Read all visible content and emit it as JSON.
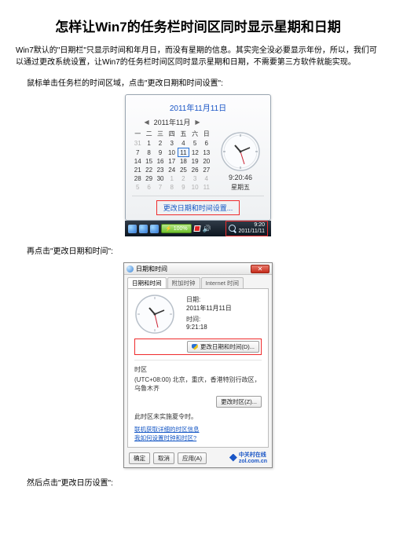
{
  "title": "怎样让Win7的任务栏时间区同时显示星期和日期",
  "intro": "Win7默认的\"日期栏\"只显示时间和年月日，而没有星期的信息。其实完全没必要显示年份，所以，我们可以通过更改系统设置，让Win7的任务栏时间区同时显示星期和日期，不需要第三方软件就能实现。",
  "step1": "鼠标单击任务栏的时间区域，点击\"更改日期和时间设置\":",
  "step2": "再点击\"更改日期和时间\":",
  "step3": "然后点击\"更改日历设置\":",
  "calendar": {
    "today_full": "2011年11月11日",
    "month_label": "2011年11月",
    "dow": [
      "一",
      "二",
      "三",
      "四",
      "五",
      "六",
      "日"
    ],
    "rows": [
      {
        "cells": [
          "31",
          "1",
          "2",
          "3",
          "4",
          "5",
          "6"
        ],
        "other": [
          0
        ]
      },
      {
        "cells": [
          "7",
          "8",
          "9",
          "10",
          "11",
          "12",
          "13"
        ],
        "sel": 4
      },
      {
        "cells": [
          "14",
          "15",
          "16",
          "17",
          "18",
          "19",
          "20"
        ]
      },
      {
        "cells": [
          "21",
          "22",
          "23",
          "24",
          "25",
          "26",
          "27"
        ]
      },
      {
        "cells": [
          "28",
          "29",
          "30",
          "1",
          "2",
          "3",
          "4"
        ],
        "other": [
          3,
          4,
          5,
          6
        ]
      },
      {
        "cells": [
          "5",
          "6",
          "7",
          "8",
          "9",
          "10",
          "11"
        ],
        "other": [
          0,
          1,
          2,
          3,
          4,
          5,
          6
        ]
      }
    ],
    "clock_time": "9:20:46",
    "clock_day": "星期五",
    "change_link": "更改日期和时间设置..."
  },
  "taskbar": {
    "battery": "100%",
    "zoom_icon_name": "magnifier-icon",
    "clock_time": "9:20",
    "clock_date": "2011/11/11"
  },
  "dialog": {
    "title": "日期和时间",
    "tabs": [
      "日期和时间",
      "附加时钟",
      "Internet 时间"
    ],
    "date_label": "日期:",
    "date_value": "2011年11月11日",
    "time_label": "时间:",
    "time_value": "9:21:18",
    "change_dt_btn": "更改日期和时间(D)...",
    "tz_heading": "时区",
    "tz_value": "(UTC+08:00) 北京，重庆，香港特别行政区，乌鲁木齐",
    "tz_btn": "更改时区(Z)...",
    "dst_note": "此时区未实施夏令时。",
    "link1": "联机获取详细的时区信息",
    "link2": "我如何设置时钟和时区?",
    "ok": "确定",
    "cancel": "取消",
    "apply": "应用(A)",
    "zol_text": "中关村在线",
    "zol_url": "zol.com.cn"
  }
}
